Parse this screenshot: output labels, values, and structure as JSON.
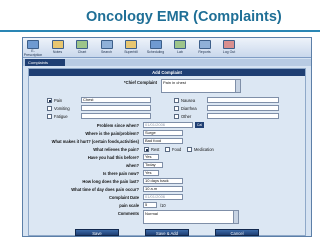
{
  "slide": {
    "title": "Oncology EMR (Complaints)"
  },
  "toolbar": {
    "items": [
      {
        "label": "E-\nPrescription",
        "icon": "prescription-icon"
      },
      {
        "label": "Notes",
        "icon": "notes-icon"
      },
      {
        "label": "Chart",
        "icon": "chart-icon"
      },
      {
        "label": "Search",
        "icon": "search-icon"
      },
      {
        "label": "Superbill",
        "icon": "superbill-icon"
      },
      {
        "label": "Scheduling",
        "icon": "calendar-icon"
      },
      {
        "label": "Lab",
        "icon": "lab-icon"
      },
      {
        "label": "Reports",
        "icon": "reports-icon"
      },
      {
        "label": "Log Out",
        "icon": "logout-icon"
      }
    ]
  },
  "tabs": {
    "active": "Complaints"
  },
  "form": {
    "title": "Add Complaint",
    "chief_complaint_label": "*Chief Complaint",
    "chief_complaint_value": "Pain in chest",
    "symptoms": [
      {
        "label": "Pain",
        "checked": true,
        "detail": "Chest"
      },
      {
        "label": "Vomiting",
        "checked": false,
        "detail": ""
      },
      {
        "label": "Fatigue",
        "checked": false,
        "detail": ""
      },
      {
        "label": "Nausea",
        "checked": false,
        "detail": ""
      },
      {
        "label": "Diarrhea",
        "checked": false,
        "detail": ""
      },
      {
        "label": "Other",
        "checked": false,
        "detail": ""
      }
    ],
    "problem_since_label": "Problem since when?",
    "problem_since_value": "01/01/2006",
    "location_label": "Where is the pain/problem?",
    "location_value": "Surge",
    "worse_label": "What makes it hurt? (certain foods,activities)",
    "worse_value": "Bad food",
    "relieves_label": "What relieves the pain?",
    "relieves_options": [
      {
        "label": "Rest",
        "checked": true
      },
      {
        "label": "Food",
        "checked": false
      },
      {
        "label": "Medication",
        "checked": false
      }
    ],
    "had_before_label": "Have you had this before?",
    "had_before_value": "Yes",
    "when_label": "when?",
    "when_value": "Today",
    "pain_now_label": "Is there pain now?",
    "pain_now_value": "Yes",
    "how_long_label": "How long does the pain last?",
    "how_long_value": "10 days back",
    "time_of_day_label": "What time of day does pain occur?",
    "time_of_day_value": "10 a.m",
    "complaint_date_label": "Complaint Date",
    "complaint_date_value": "01/01/2006",
    "pain_scale_label": "pain scale",
    "pain_scale_value": "5",
    "pain_scale_max": "/10",
    "comments_label": "Comments",
    "comments_value": "Normal",
    "cal_label": "Cal"
  },
  "buttons": {
    "save": "Save",
    "save_add": "Save & Add",
    "cancel": "Cancel"
  },
  "colors": {
    "title": "#1f6f96",
    "header_bar": "#1f3f73",
    "panel_bg": "#dce7f3"
  }
}
